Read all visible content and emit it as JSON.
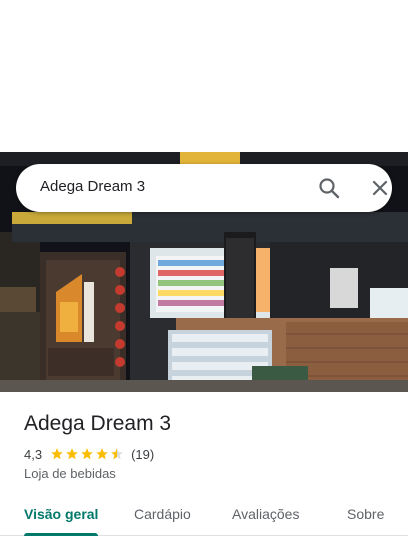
{
  "search": {
    "query": "Adega Dream 3",
    "search_icon": "search-icon",
    "close_icon": "close-icon"
  },
  "photo": {
    "description_icon": "storefront-photo"
  },
  "place": {
    "name": "Adega Dream 3",
    "rating": "4,3",
    "rating_stars": 4.3,
    "review_count": "(19)",
    "category": "Loja de bebidas"
  },
  "tabs": [
    {
      "label": "Visão geral",
      "active": true
    },
    {
      "label": "Cardápio",
      "active": false
    },
    {
      "label": "Avaliações",
      "active": false
    },
    {
      "label": "Sobre",
      "active": false
    }
  ],
  "colors": {
    "accent": "#00796b",
    "star": "#fbbc04",
    "star_empty": "#dadce0"
  }
}
